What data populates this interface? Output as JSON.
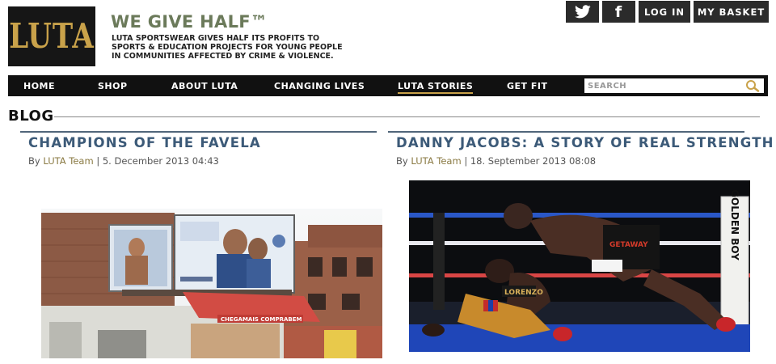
{
  "brand": {
    "logo_text": "LUTA",
    "tagline_title": "WE GIVE HALF™",
    "tagline_body": "LUTA SPORTSWEAR GIVES HALF ITS PROFITS TO SPORTS & EDUCATION PROJECTS FOR YOUNG PEOPLE IN COMMUNITIES AFFECTED BY CRIME & VIOLENCE.",
    "logo_color": "#c9a24a"
  },
  "top_actions": {
    "twitter_icon": "twitter-icon",
    "facebook_icon": "facebook-icon",
    "facebook_glyph": "f",
    "login_label": "LOG IN",
    "basket_label": "MY BASKET"
  },
  "nav": {
    "items": [
      {
        "label": "HOME"
      },
      {
        "label": "SHOP"
      },
      {
        "label": "ABOUT LUTA"
      },
      {
        "label": "CHANGING LIVES"
      },
      {
        "label": "LUTA STORIES"
      },
      {
        "label": "GET FIT"
      }
    ],
    "active": "LUTA STORIES",
    "search_placeholder": "SEARCH"
  },
  "page": {
    "title": "BLOG"
  },
  "posts": [
    {
      "title": "CHAMPIONS OF THE FAVELA",
      "by_prefix": "By ",
      "author": "LUTA Team",
      "date": " | 5. December 2013 04:43",
      "billboard_text": "CHEGAMAIS COMPRABEM"
    },
    {
      "title": "DANNY JACOBS: A STORY OF REAL STRENGTH",
      "by_prefix": "By ",
      "author": "LUTA Team",
      "date": " | 18. September 2013 08:08",
      "corner_post_text": "GOLDEN BOY",
      "trunks_text": "GETAWAY",
      "shirt_text": "LORENZO"
    }
  ],
  "colors": {
    "accent_blue": "#3c5a78",
    "nav_bg": "#111111",
    "link_gold": "#8a7a43"
  }
}
